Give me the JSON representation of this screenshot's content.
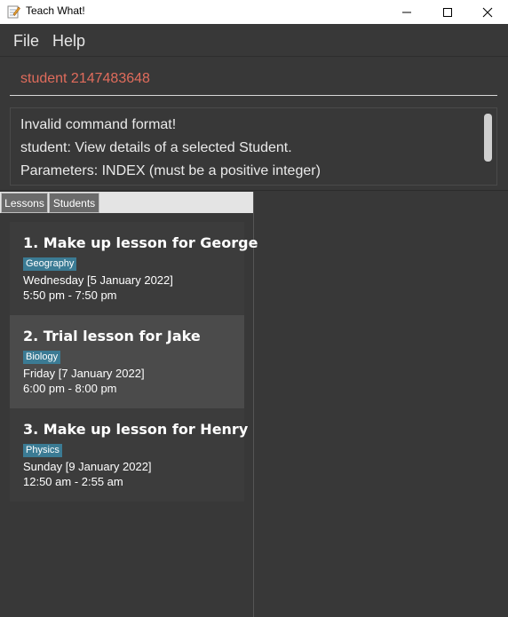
{
  "window": {
    "title": "Teach What!",
    "icon": "notepad-pencil-icon"
  },
  "menu": {
    "file": "File",
    "help": "Help"
  },
  "command": {
    "value": "student 2147483648"
  },
  "result": {
    "lines": [
      "Invalid command format!",
      "student: View details of a selected Student.",
      "Parameters: INDEX (must be a positive integer)"
    ]
  },
  "tabs": [
    {
      "label": "Lessons"
    },
    {
      "label": "Students"
    }
  ],
  "lessons": [
    {
      "title": "1.  Make up lesson for George",
      "tag": "Geography",
      "date": "Wednesday [5 January 2022]",
      "time": "5:50 pm - 7:50 pm"
    },
    {
      "title": "2.  Trial lesson for Jake",
      "tag": "Biology",
      "date": "Friday [7 January 2022]",
      "time": "6:00 pm - 8:00 pm"
    },
    {
      "title": "3.  Make up lesson for Henry",
      "tag": "Physics",
      "date": "Sunday [9 January 2022]",
      "time": "12:50 am - 2:55 am"
    }
  ],
  "colors": {
    "accent_tag": "#3b7b94",
    "error_text": "#e06c5c",
    "background": "#383838"
  }
}
